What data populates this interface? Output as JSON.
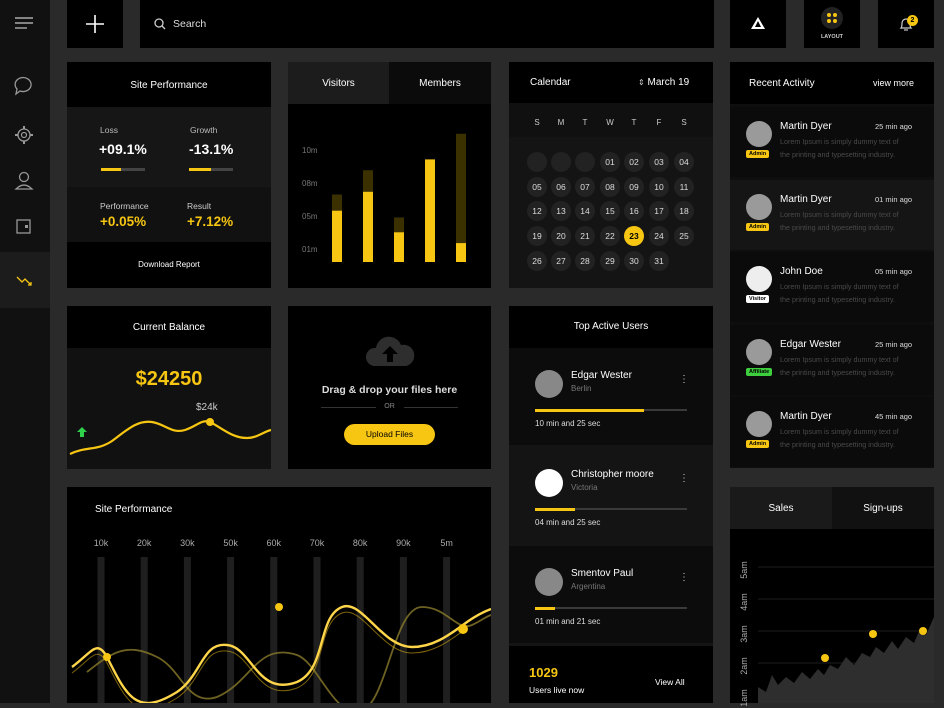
{
  "topbar": {
    "search_placeholder": "Search",
    "layout_label": "LAYOUT",
    "notification_count": "2"
  },
  "site_perf": {
    "title": "Site Performance",
    "loss_label": "Loss",
    "loss_value": "+09.1%",
    "loss_progress": 0.45,
    "growth_label": "Growth",
    "growth_value": "-13.1%",
    "growth_progress": 0.5,
    "performance_label": "Performance",
    "performance_value": "+0.05%",
    "result_label": "Result",
    "result_value": "+7.12%",
    "download_label": "Download Report"
  },
  "visitors": {
    "tab_visitors": "Visitors",
    "tab_members": "Members",
    "ylabels": [
      "10m",
      "08m",
      "05m",
      "01m"
    ],
    "values": [
      0.38,
      0.52,
      0.22,
      0.76,
      0.14
    ],
    "bg_values": [
      0.5,
      0.68,
      0.33,
      0.0,
      0.95
    ]
  },
  "calendar": {
    "title": "Calendar",
    "month": "March",
    "year": "19",
    "dow": [
      "S",
      "M",
      "T",
      "W",
      "T",
      "F",
      "S"
    ],
    "days": [
      "",
      "",
      "",
      "01",
      "02",
      "03",
      "04",
      "05",
      "06",
      "07",
      "08",
      "09",
      "10",
      "11",
      "12",
      "13",
      "14",
      "15",
      "16",
      "17",
      "18",
      "19",
      "20",
      "21",
      "22",
      "23",
      "24",
      "25",
      "26",
      "27",
      "28",
      "29",
      "30",
      "31"
    ],
    "selected": "23"
  },
  "activity": {
    "title": "Recent Activity",
    "view_more": "view more",
    "items": [
      {
        "name": "Martin Dyer",
        "time": "25 min ago",
        "badge": "Admin",
        "text1": "Lorem Ipsum is simply dummy text of",
        "text2": "the printing and typesetting industry."
      },
      {
        "name": "Martin Dyer",
        "time": "01 min ago",
        "badge": "Admin",
        "text1": "Lorem Ipsum is simply dummy text of",
        "text2": "the printing and typesetting industry."
      },
      {
        "name": "John Doe",
        "time": "05 min ago",
        "badge": "Visitor",
        "text1": "Lorem Ipsum is simply dummy text of",
        "text2": "the printing and typesetting industry."
      },
      {
        "name": "Edgar Wester",
        "time": "25 min ago",
        "badge": "Affiliate",
        "text1": "Lorem Ipsum is simply dummy text of",
        "text2": "the printing and typesetting industry."
      },
      {
        "name": "Martin Dyer",
        "time": "45 min ago",
        "badge": "Admin",
        "text1": "Lorem Ipsum is simply dummy text of",
        "text2": "the printing and typesetting industry."
      }
    ]
  },
  "balance": {
    "title": "Current Balance",
    "amount": "$24250",
    "peak": "$24k"
  },
  "upload": {
    "drag_text": "Drag & drop your files here",
    "or": "OR",
    "button": "Upload Files"
  },
  "top_users": {
    "title": "Top Active Users",
    "users": [
      {
        "name": "Edgar Wester",
        "location": "Berlin",
        "time": "10 min and 25 sec",
        "progress": 0.72
      },
      {
        "name": "Christopher moore",
        "location": "Victoria",
        "time": "04 min and 25 sec",
        "progress": 0.26
      },
      {
        "name": "Smentov Paul",
        "location": "Argentina",
        "time": "01 min and 21 sec",
        "progress": 0.13
      }
    ],
    "live_count": "1029",
    "live_label": "Users live now",
    "view_all": "View All"
  },
  "site_perf2": {
    "title": "Site Performance",
    "xlabels": [
      "10k",
      "20k",
      "30k",
      "50k",
      "60k",
      "70k",
      "80k",
      "90k",
      "5m"
    ]
  },
  "sales": {
    "tab_sales": "Sales",
    "tab_signups": "Sign-ups",
    "ylabels": [
      "5am",
      "4am",
      "3am",
      "2am",
      "1am"
    ]
  }
}
